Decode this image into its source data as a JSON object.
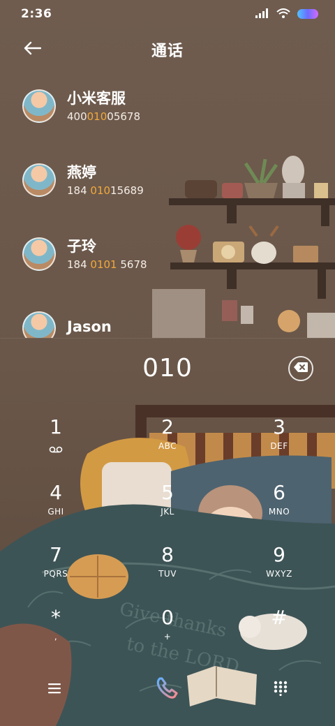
{
  "status_bar": {
    "time": "2:36",
    "icons": [
      "signal-icon",
      "wifi-icon",
      "battery-icon"
    ]
  },
  "header": {
    "title": "通话",
    "back_icon": "arrow-left-icon"
  },
  "contacts": [
    {
      "name": "小米客服",
      "number_before": "400",
      "number_match": "010",
      "number_after": "05678"
    },
    {
      "name": "燕婷",
      "number_before": "184 ",
      "number_match": "010",
      "number_after": "15689"
    },
    {
      "name": "子玲",
      "number_before": "184 ",
      "number_match": "0101",
      "number_after": " 5678"
    },
    {
      "name": "Jason",
      "number_before": "",
      "number_match": "",
      "number_after": ""
    }
  ],
  "dial": {
    "number": "010",
    "delete_icon": "backspace-icon"
  },
  "keypad": [
    {
      "digit": "1",
      "letters": "",
      "icon": "voicemail-icon"
    },
    {
      "digit": "2",
      "letters": "ABC"
    },
    {
      "digit": "3",
      "letters": "DEF"
    },
    {
      "digit": "4",
      "letters": "GHI"
    },
    {
      "digit": "5",
      "letters": "JKL"
    },
    {
      "digit": "6",
      "letters": "MNO"
    },
    {
      "digit": "7",
      "letters": "PQRS"
    },
    {
      "digit": "8",
      "letters": "TUV"
    },
    {
      "digit": "9",
      "letters": "WXYZ"
    },
    {
      "digit": "*",
      "letters": ","
    },
    {
      "digit": "0",
      "letters": "+"
    },
    {
      "digit": "#",
      "letters": ""
    }
  ],
  "bottom_bar": {
    "menu_icon": "menu-icon",
    "call_icon": "phone-icon",
    "keypad_icon": "dialpad-icon"
  },
  "colors": {
    "background": "#6d5b4e",
    "match_highlight": "#f2a93b",
    "call_button_gradient": [
      "#ff8a8a",
      "#5fb0ff"
    ]
  }
}
